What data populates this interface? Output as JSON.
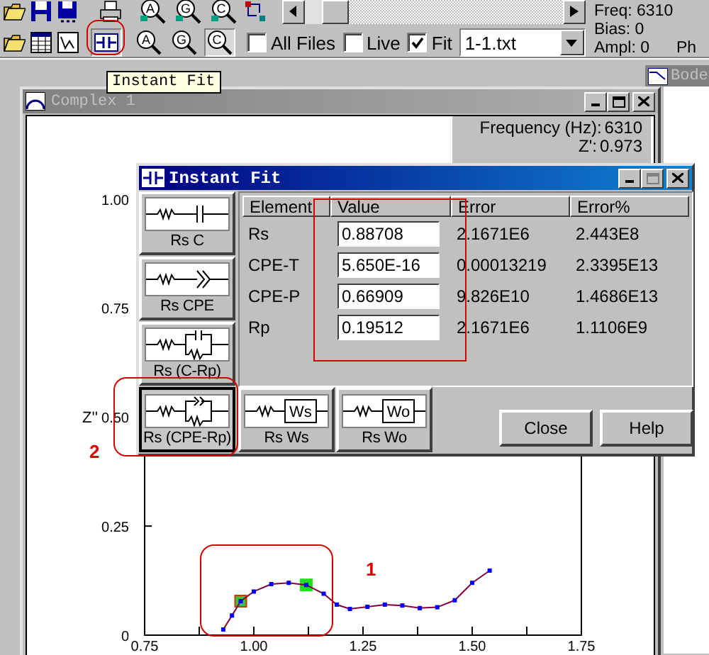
{
  "toolbar": {
    "zoom_tools": [
      {
        "letter": "A"
      },
      {
        "letter": "G"
      },
      {
        "letter": "C"
      },
      {
        "letter": "A"
      },
      {
        "letter": "G"
      },
      {
        "letter": "C"
      }
    ],
    "checkboxes": [
      {
        "label": "All Files",
        "checked": false
      },
      {
        "label": "Live",
        "checked": false
      },
      {
        "label": "Fit",
        "checked": true
      }
    ],
    "file_select": {
      "value": "1-1.txt"
    },
    "readouts": [
      "Freq: 6310",
      "Bias: 0",
      "Ampl: 0"
    ],
    "readout_cut": "Ph"
  },
  "tooltip": "Instant Fit",
  "bode_window": {
    "title": "Bode"
  },
  "complex_window": {
    "title": "Complex 1",
    "info": [
      {
        "label": "Frequency (Hz):",
        "value": "6310"
      },
      {
        "label": "Z':",
        "value": "0.973"
      }
    ],
    "chart_data": {
      "type": "line",
      "ylabel": "Z''",
      "x": [
        0.93,
        0.95,
        0.97,
        1.0,
        1.04,
        1.08,
        1.12,
        1.16,
        1.19,
        1.22,
        1.26,
        1.3,
        1.34,
        1.38,
        1.42,
        1.46,
        1.5,
        1.54
      ],
      "series": [
        {
          "color": "#0000ff",
          "marker": true,
          "values": [
            0.013,
            0.045,
            0.078,
            0.1,
            0.117,
            0.12,
            0.115,
            0.095,
            0.07,
            0.06,
            0.065,
            0.07,
            0.068,
            0.062,
            0.064,
            0.08,
            0.12,
            0.148
          ]
        }
      ],
      "xlim": [
        0.75,
        1.75
      ],
      "ylim": [
        0,
        1.04
      ],
      "xticks": [
        {
          "value": 0.75,
          "label": "0.75"
        },
        {
          "value": 1,
          "label": "1.00"
        },
        {
          "value": 1.25,
          "label": "1.25"
        },
        {
          "value": 1.5,
          "label": "1.50"
        },
        {
          "value": 1.75,
          "label": "1.75"
        }
      ],
      "yticks": [
        {
          "value": 0,
          "label": "0"
        },
        {
          "value": 0.25,
          "label": "0.25"
        },
        {
          "value": 0.5,
          "label": "0.50"
        },
        {
          "value": 0.75,
          "label": "0.75"
        },
        {
          "value": 1,
          "label": "1.00"
        }
      ]
    }
  },
  "instant_fit": {
    "title": "Instant Fit",
    "models": [
      {
        "label": "Rs C",
        "kind": "c",
        "selected": false
      },
      {
        "label": "Rs CPE",
        "kind": "cpe",
        "selected": false
      },
      {
        "label": "Rs (C-Rp)",
        "kind": "c-rp",
        "selected": false
      },
      {
        "label": "Rs (CPE-Rp)",
        "kind": "cpe-rp",
        "selected": true
      },
      {
        "label": "Rs Ws",
        "kind": "box",
        "symbol": "Ws",
        "selected": false
      },
      {
        "label": "Rs Wo",
        "kind": "box",
        "symbol": "Wo",
        "selected": false
      }
    ],
    "table": {
      "columns": [
        "Element",
        "Value",
        "Error",
        "Error%"
      ],
      "rows": [
        {
          "element": "Rs",
          "value": "0.88708",
          "error": "2.1671E6",
          "error_pct": "2.443E8"
        },
        {
          "element": "CPE-T",
          "value": "5.650E-16",
          "error": "0.00013219",
          "error_pct": "2.3395E13"
        },
        {
          "element": "CPE-P",
          "value": "0.66909",
          "error": "9.826E10",
          "error_pct": "1.4686E13"
        },
        {
          "element": "Rp",
          "value": "0.19512",
          "error": "2.1671E6",
          "error_pct": "1.1106E9"
        }
      ]
    },
    "buttons": [
      "Close",
      "Help"
    ]
  },
  "annotations": [
    {
      "label": "1"
    },
    {
      "label": "2"
    }
  ]
}
